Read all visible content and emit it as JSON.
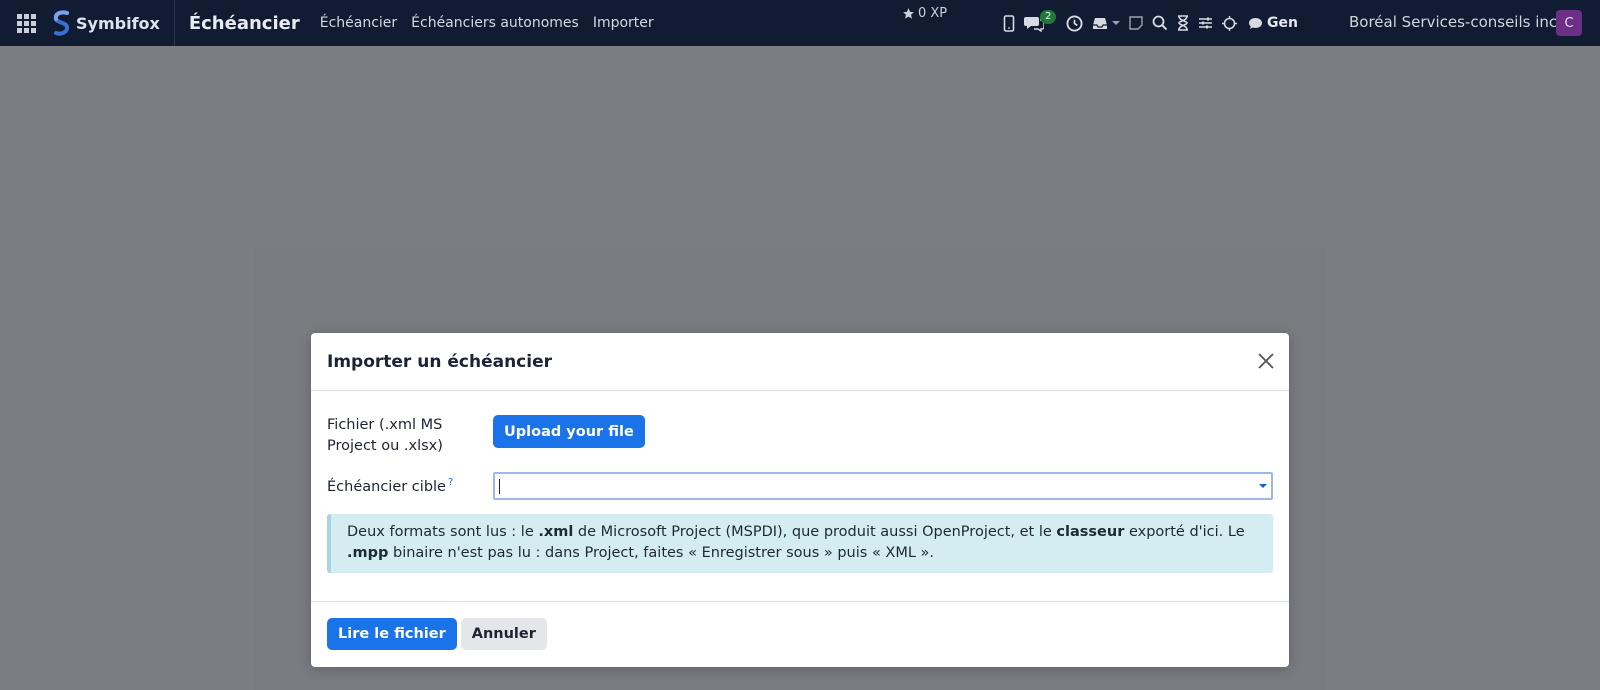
{
  "navbar": {
    "apps_icon": "apps-grid-icon",
    "brand": "Symbifox",
    "module_title": "Échéancier",
    "menu": [
      "Échéancier",
      "Échéanciers autonomes",
      "Importer"
    ],
    "xp": "0 XP",
    "messages_count": "2",
    "gen_label": "Gen",
    "company": "Boréal Services-conseils inc.",
    "avatar_letter": "C"
  },
  "modal": {
    "title": "Importer un échéancier",
    "file_label": "Fichier (.xml MS Project ou .xlsx)",
    "upload_label": "Upload your file",
    "target_label": "Échéancier cible",
    "help_mark": "?",
    "target_value": "",
    "info": {
      "p1": "Deux formats sont lus : le ",
      "b1": ".xml",
      "p2": " de Microsoft Project (MSPDI), que produit aussi OpenProject, et le ",
      "b2": "classeur",
      "p3": " exporté d'ici. Le ",
      "b3": ".mpp",
      "p4": " binaire n'est pas lu : dans Project, faites « Enregistrer sous » puis « XML »."
    },
    "primary_label": "Lire le fichier",
    "secondary_label": "Annuler"
  },
  "colors": {
    "navbar_bg": "#111c33",
    "accent": "#1a73e8",
    "backdrop": "#7b7d82",
    "info_bg": "#d4edf2"
  }
}
